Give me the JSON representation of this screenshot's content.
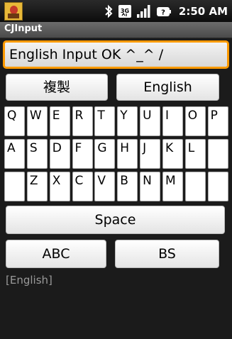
{
  "status_bar": {
    "time": "2:50 AM",
    "network_type": "3G",
    "icons": [
      "bluetooth-icon",
      "3g-network-icon",
      "signal-icon",
      "battery-icon"
    ]
  },
  "app": {
    "title": "CJInput"
  },
  "input": {
    "value": "English Input OK ^_^ /"
  },
  "top_buttons": {
    "duplicate": "複製",
    "language": "English"
  },
  "keyboard": {
    "rows": [
      [
        "Q",
        "W",
        "E",
        "R",
        "T",
        "Y",
        "U",
        "I",
        "O",
        "P"
      ],
      [
        "A",
        "S",
        "D",
        "F",
        "G",
        "H",
        "J",
        "K",
        "L",
        ""
      ],
      [
        "",
        "Z",
        "X",
        "C",
        "V",
        "B",
        "N",
        "M",
        "",
        ""
      ]
    ]
  },
  "bottom_buttons": {
    "space": "Space",
    "abc": "ABC",
    "backspace": "BS"
  },
  "mode_indicator": "[English]",
  "colors": {
    "accent": "#ff9a00",
    "background": "#1b1b1b",
    "key_bg": "#ffffff"
  }
}
